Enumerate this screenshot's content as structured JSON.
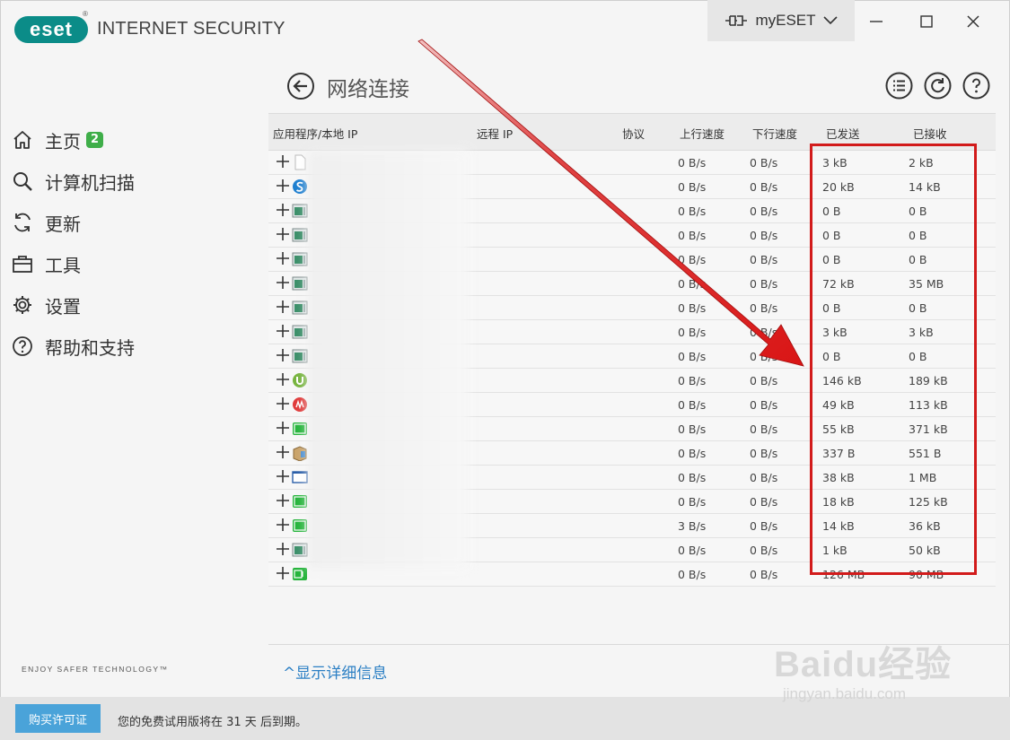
{
  "app": {
    "logo": "eset",
    "product": "INTERNET SECURITY",
    "account_label": "myESET",
    "colors": {
      "accent": "#0b8c88",
      "badge_green": "#3fae49",
      "link_blue": "#2b7fc4",
      "button_blue": "#4aa3d9",
      "highlight_red": "#d21b1b"
    }
  },
  "window_controls": [
    "minimize-icon",
    "maximize-icon",
    "close-icon"
  ],
  "sidebar": {
    "items": [
      {
        "label": "主页",
        "icon": "home-icon",
        "badge": "2"
      },
      {
        "label": "计算机扫描",
        "icon": "search-icon"
      },
      {
        "label": "更新",
        "icon": "refresh-icon"
      },
      {
        "label": "工具",
        "icon": "briefcase-icon"
      },
      {
        "label": "设置",
        "icon": "gear-icon"
      },
      {
        "label": "帮助和支持",
        "icon": "help-icon"
      }
    ],
    "tagline": "ENJOY SAFER TECHNOLOGY™"
  },
  "page": {
    "title": "网络连接",
    "top_icons": [
      "list-icon",
      "refresh-icon",
      "help-icon"
    ]
  },
  "table": {
    "columns": [
      "应用程序/本地 IP",
      "远程 IP",
      "协议",
      "上行速度",
      "下行速度",
      "已发送",
      "已接收"
    ],
    "rows": [
      {
        "icon": "file-icon",
        "up": "0 B/s",
        "down": "0 B/s",
        "sent": "3 kB",
        "recv": "2 kB"
      },
      {
        "icon": "app-s-icon",
        "up": "0 B/s",
        "down": "0 B/s",
        "sent": "20 kB",
        "recv": "14 kB"
      },
      {
        "icon": "window-app-icon",
        "up": "0 B/s",
        "down": "0 B/s",
        "sent": "0 B",
        "recv": "0 B"
      },
      {
        "icon": "window-app-icon",
        "up": "0 B/s",
        "down": "0 B/s",
        "sent": "0 B",
        "recv": "0 B"
      },
      {
        "icon": "window-app-icon",
        "up": "0 B/s",
        "down": "0 B/s",
        "sent": "0 B",
        "recv": "0 B"
      },
      {
        "icon": "window-app-icon",
        "up": "0 B/s",
        "down": "0 B/s",
        "sent": "72 kB",
        "recv": "35 MB"
      },
      {
        "icon": "window-app-icon",
        "up": "0 B/s",
        "down": "0 B/s",
        "sent": "0 B",
        "recv": "0 B"
      },
      {
        "icon": "window-app-icon",
        "up": "0 B/s",
        "down": "0 B/s",
        "sent": "3 kB",
        "recv": "3 kB"
      },
      {
        "icon": "window-app-icon",
        "up": "0 B/s",
        "down": "0 B/s",
        "sent": "0 B",
        "recv": "0 B"
      },
      {
        "icon": "utorrent-icon",
        "up": "0 B/s",
        "down": "0 B/s",
        "sent": "146 kB",
        "recv": "189 kB"
      },
      {
        "icon": "red-app-icon",
        "up": "0 B/s",
        "down": "0 B/s",
        "sent": "49 kB",
        "recv": "113 kB"
      },
      {
        "icon": "iqiyi-icon",
        "up": "0 B/s",
        "down": "0 B/s",
        "sent": "55 kB",
        "recv": "371 kB"
      },
      {
        "icon": "package-icon",
        "up": "0 B/s",
        "down": "0 B/s",
        "sent": "337 B",
        "recv": "551 B"
      },
      {
        "icon": "blank-window-icon",
        "up": "0 B/s",
        "down": "0 B/s",
        "sent": "38 kB",
        "recv": "1 MB"
      },
      {
        "icon": "iqiyi-icon",
        "up": "0 B/s",
        "down": "0 B/s",
        "sent": "18 kB",
        "recv": "125 kB"
      },
      {
        "icon": "iqiyi-icon",
        "up": "3 B/s",
        "down": "0 B/s",
        "sent": "14 kB",
        "recv": "36 kB"
      },
      {
        "icon": "window-app-icon",
        "up": "0 B/s",
        "down": "0 B/s",
        "sent": "1 kB",
        "recv": "50 kB"
      },
      {
        "icon": "iqiyi-tv-icon",
        "up": "0 B/s",
        "down": "0 B/s",
        "sent": "126 MB",
        "recv": "90 MB"
      }
    ]
  },
  "footer": {
    "details_link": "显示详细信息",
    "buy_button": "购买许可证",
    "trial_text": "您的免费试用版将在 31 天 后到期。"
  },
  "watermark": {
    "brand": "Baidu经验",
    "url": "jingyan.baidu.com"
  }
}
